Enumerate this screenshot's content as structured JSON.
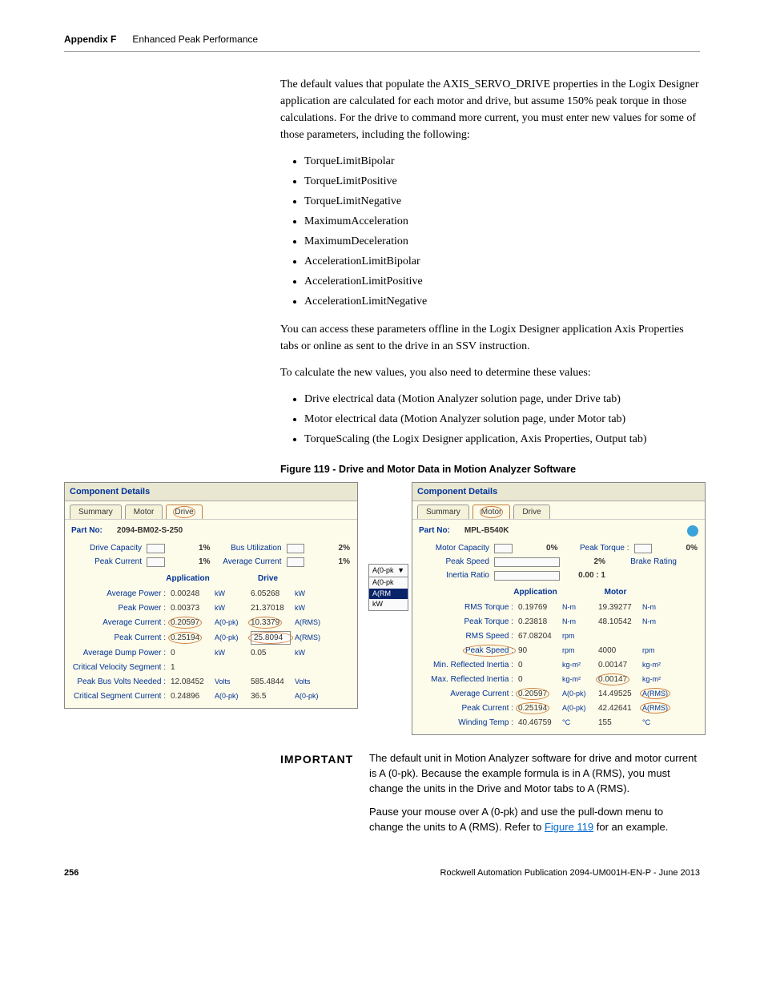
{
  "header": {
    "appendix": "Appendix F",
    "title": "Enhanced Peak Performance"
  },
  "body": {
    "p1": "The default values that populate the AXIS_SERVO_DRIVE properties in the Logix Designer application are calculated for each motor and drive, but assume 150% peak torque in those calculations. For the drive to command more current, you must enter new values for some of those parameters, including the following:",
    "list1": [
      "TorqueLimitBipolar",
      "TorqueLimitPositive",
      "TorqueLimitNegative",
      "MaximumAcceleration",
      "MaximumDeceleration",
      "AccelerationLimitBipolar",
      "AccelerationLimitPositive",
      "AccelerationLimitNegative"
    ],
    "p2": "You can access these parameters offline in the Logix Designer application Axis Properties tabs or online as sent to the drive in an SSV instruction.",
    "p3": "To calculate the new values, you also need to determine these values:",
    "list2": [
      "Drive electrical data (Motion Analyzer solution page, under Drive tab)",
      "Motor electrical data (Motion Analyzer solution page, under Motor tab)",
      "TorqueScaling  (the Logix Designer application, Axis Properties, Output tab)"
    ]
  },
  "figCaption": "Figure 119 - Drive and Motor Data in Motion Analyzer Software",
  "drivePanel": {
    "title": "Component Details",
    "tabs": [
      "Summary",
      "Motor",
      "Drive"
    ],
    "activeTab": "Drive",
    "partNoLabel": "Part No:",
    "partNo": "2094-BM02-S-250",
    "topRows": [
      {
        "l": "Drive Capacity",
        "v": "1%",
        "l2": "Bus Utilization",
        "v2": "2%"
      },
      {
        "l": "Peak Current",
        "v": "1%",
        "l2": "Average Current",
        "v2": "1%"
      }
    ],
    "cols": {
      "col1": "Application",
      "col2": "Drive"
    },
    "rows": [
      {
        "l": "Average Power :",
        "a": "0.00248",
        "au": "kW",
        "b": "6.05268",
        "bu": "kW"
      },
      {
        "l": "Peak Power :",
        "a": "0.00373",
        "au": "kW",
        "b": "21.37018",
        "bu": "kW"
      },
      {
        "l": "Average Current :",
        "a": "0.20597",
        "au": "A(0-pk)",
        "b": "10.3379",
        "bu": "A(RMS)",
        "circA": true,
        "circB": true
      },
      {
        "l": "Peak Current :",
        "a": "0.25194",
        "au": "A(0-pk)",
        "b": "25.8094",
        "bu": "A(RMS)",
        "inputB": true,
        "circA": true,
        "circB": true
      },
      {
        "l": "Average Dump Power :",
        "a": "0",
        "au": "kW",
        "b": "0.05",
        "bu": "kW"
      },
      {
        "l": "Critical Velocity Segment :",
        "a": "1",
        "au": "",
        "b": "",
        "bu": ""
      },
      {
        "l": "Peak Bus Volts Needed :",
        "a": "12.08452",
        "au": "Volts",
        "b": "585.4844",
        "bu": "Volts"
      },
      {
        "l": "Critical Segment Current :",
        "a": "0.24896",
        "au": "A(0-pk)",
        "b": "36.5",
        "bu": "A(0-pk)"
      }
    ]
  },
  "dropdown": {
    "top": "A(0-pk",
    "items": [
      "A(0-pk",
      "A(RM",
      "kW"
    ],
    "highlight": 1
  },
  "motorPanel": {
    "title": "Component Details",
    "tabs": [
      "Summary",
      "Motor",
      "Drive"
    ],
    "activeTab": "Motor",
    "partNoLabel": "Part No:",
    "partNo": "MPL-B540K",
    "topRows": [
      {
        "l": "Motor Capacity",
        "v": "0%",
        "l2": "Peak Torque :",
        "v2": "0%"
      },
      {
        "l": "Peak Speed",
        "v": "2%",
        "l2": "Brake Rating",
        "v2": ""
      },
      {
        "l": "Inertia Ratio",
        "v": "0.00 : 1",
        "l2": "",
        "v2": ""
      }
    ],
    "cols": {
      "col1": "Application",
      "col2": "Motor"
    },
    "rows": [
      {
        "l": "RMS Torque :",
        "a": "0.19769",
        "au": "N-m",
        "b": "19.39277",
        "bu": "N-m"
      },
      {
        "l": "Peak Torque :",
        "a": "0.23818",
        "au": "N-m",
        "b": "48.10542",
        "bu": "N-m"
      },
      {
        "l": "RMS Speed :",
        "a": "67.08204",
        "au": "rpm",
        "b": "",
        "bu": ""
      },
      {
        "l": "Peak Speed :",
        "a": "90",
        "au": "rpm",
        "b": "4000",
        "bu": "rpm",
        "circL": true
      },
      {
        "l": "Min. Reflected Inertia :",
        "a": "0",
        "au": "kg-m²",
        "b": "0.00147",
        "bu": "kg-m²"
      },
      {
        "l": "Max. Reflected Inertia :",
        "a": "0",
        "au": "kg-m²",
        "b": "0.00147",
        "bu": "kg-m²",
        "circB": true
      },
      {
        "l": "Average Current :",
        "a": "0.20597",
        "au": "A(0-pk)",
        "b": "14.49525",
        "bu": "A(RMS)",
        "circA": true,
        "circBu": true
      },
      {
        "l": "Peak Current :",
        "a": "0.25194",
        "au": "A(0-pk)",
        "b": "42.42641",
        "bu": "A(RMS)",
        "circA": true,
        "circBu": true
      },
      {
        "l": "Winding Temp :",
        "a": "40.46759",
        "au": "°C",
        "b": "155",
        "bu": "°C"
      }
    ]
  },
  "important": {
    "label": "IMPORTANT",
    "text1a": "The default unit in Motion Analyzer software for drive and motor current is A (0-pk). Because the example formula is in A (RMS), you must change the units in the Drive and Motor tabs to A (RMS).",
    "text2a": "Pause your mouse over A (0-pk) and use the pull-down menu to change the units to A (RMS). Refer to ",
    "link": "Figure 119",
    "text2b": " for an example."
  },
  "footer": {
    "page": "256",
    "pub": "Rockwell Automation Publication 2094-UM001H-EN-P - June 2013"
  }
}
